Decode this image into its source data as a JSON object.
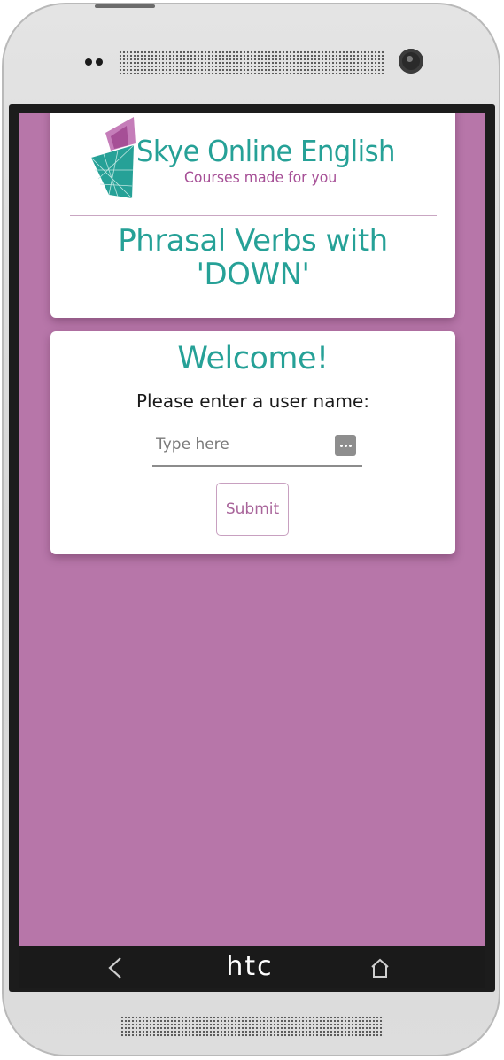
{
  "device": {
    "brand_label": "htc",
    "nav": {
      "back_icon": "back-chevron-icon",
      "home_icon": "home-icon"
    }
  },
  "header": {
    "logo_title": "Skye Online English",
    "logo_tagline": "Courses made for you",
    "page_title": "Phrasal Verbs with 'DOWN'"
  },
  "welcome": {
    "heading": "Welcome!",
    "prompt": "Please enter a user name:",
    "input_placeholder": "Type here",
    "input_value": "",
    "input_icon": "more-dots-icon",
    "submit_label": "Submit"
  },
  "colors": {
    "screen_background": "#b776a9",
    "teal": "#26a197",
    "magenta": "#a64f96"
  }
}
